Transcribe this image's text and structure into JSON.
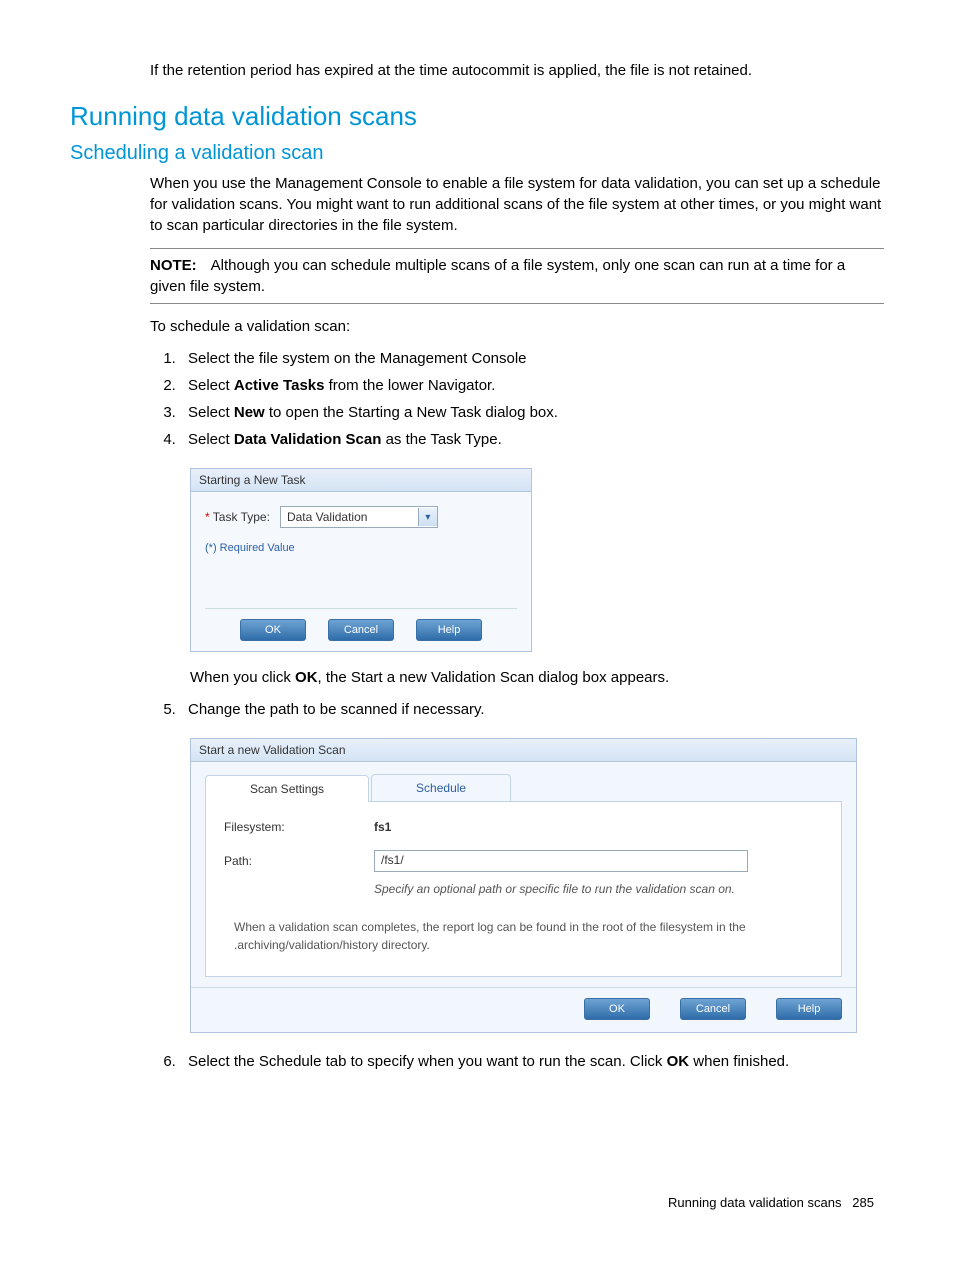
{
  "intro_para": "If the retention period has expired at the time autocommit is applied, the file is not retained.",
  "h1": "Running data validation scans",
  "h2": "Scheduling a validation scan",
  "para1": "When you use the Management Console to enable a file system for data validation, you can set up a schedule for validation scans. You might want to run additional scans of the file system at other times, or you might want to scan particular directories in the file system.",
  "note_label": "NOTE:",
  "note_text": "Although you can schedule multiple scans of a file system, only one scan can run at a time for a given file system.",
  "para2": "To schedule a validation scan:",
  "steps": {
    "s1": "Select the file system on the Management Console",
    "s2a": "Select ",
    "s2b": "Active Tasks",
    "s2c": " from the lower Navigator.",
    "s3a": "Select ",
    "s3b": "New",
    "s3c": " to open the Starting a New Task dialog box.",
    "s4a": "Select ",
    "s4b": "Data Validation Scan",
    "s4c": " as the Task Type."
  },
  "dialog1": {
    "title": "Starting a New Task",
    "task_type_label": "Task Type:",
    "task_type_value": "Data Validation",
    "required_value": "(*) Required Value",
    "ok": "OK",
    "cancel": "Cancel",
    "help": "Help"
  },
  "after_d1_a": "When you click ",
  "after_d1_b": "OK",
  "after_d1_c": ", the Start a new Validation Scan dialog box appears.",
  "step5": "Change the path to be scanned if necessary.",
  "dialog2": {
    "title": "Start a new Validation Scan",
    "tab1": "Scan Settings",
    "tab2": "Schedule",
    "fs_label": "Filesystem:",
    "fs_value": "fs1",
    "path_label": "Path:",
    "path_value": "/fs1/",
    "hint": "Specify an optional path or specific file to run the validation scan on.",
    "note": "When a validation scan completes, the report log can be found in the root of the filesystem in the .archiving/validation/history directory.",
    "ok": "OK",
    "cancel": "Cancel",
    "help": "Help"
  },
  "step6a": "Select the Schedule tab to specify when you want to run the scan. Click ",
  "step6b": "OK",
  "step6c": " when finished.",
  "footer_text": "Running data validation scans",
  "footer_page": "285"
}
